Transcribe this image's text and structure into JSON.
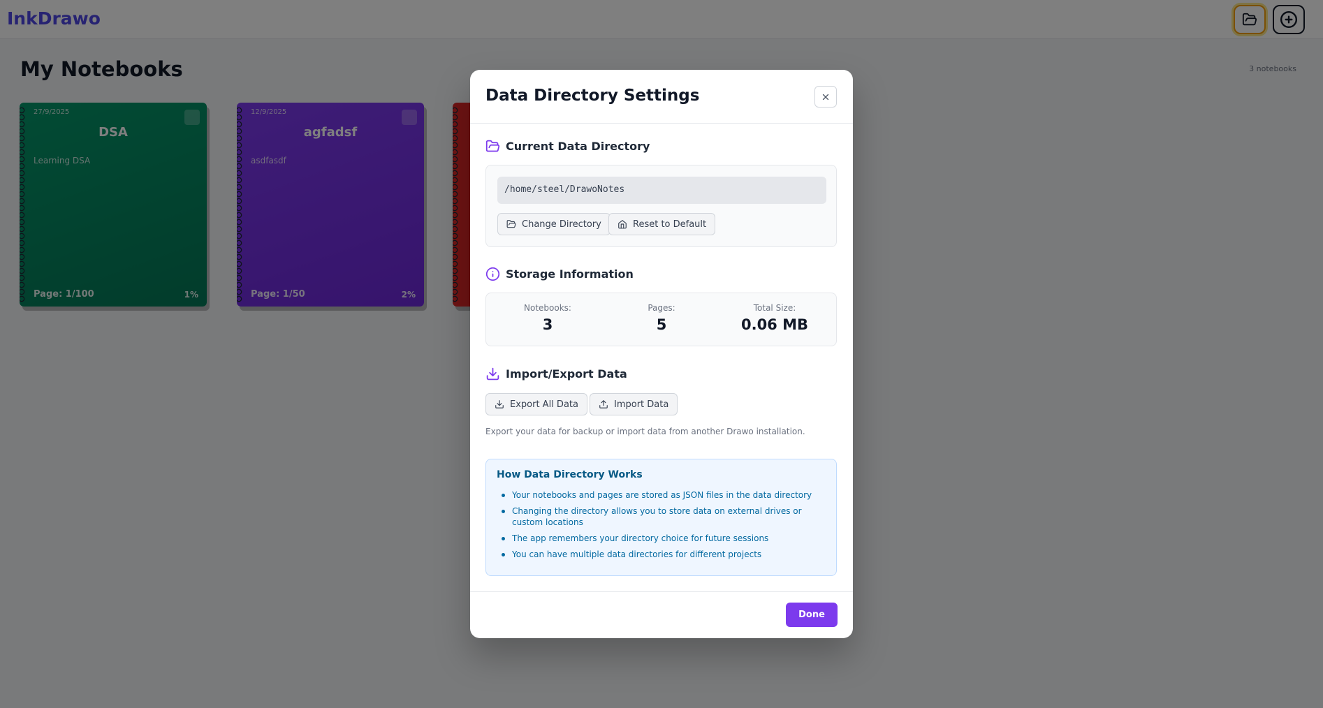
{
  "app": {
    "title": "InkDrawo"
  },
  "page": {
    "title": "My Notebooks",
    "notebook_count": "3 notebooks"
  },
  "notebooks": [
    {
      "date": "27/9/2025",
      "title": "DSA",
      "description": "Learning DSA",
      "page": "Page: 1/100",
      "progress": "1%",
      "color": "#059669"
    },
    {
      "date": "12/9/2025",
      "title": "agfadsf",
      "description": "asdfasdf",
      "page": "Page: 1/50",
      "progress": "2%",
      "color": "#7c3aed"
    },
    {
      "color": "#dc2626"
    }
  ],
  "modal": {
    "title": "Data Directory Settings",
    "current_dir": {
      "heading": "Current Data Directory",
      "path": "/home/steel/DrawoNotes",
      "change_label": "Change Directory",
      "reset_label": "Reset to Default"
    },
    "storage": {
      "heading": "Storage Information",
      "notebooks_label": "Notebooks:",
      "notebooks_value": "3",
      "pages_label": "Pages:",
      "pages_value": "5",
      "size_label": "Total Size:",
      "size_value": "0.06 MB"
    },
    "import_export": {
      "heading": "Import/Export Data",
      "export_label": "Export All Data",
      "import_label": "Import Data",
      "note": "Export your data for backup or import data from another Drawo installation."
    },
    "info": {
      "title": "How Data Directory Works",
      "items": [
        "Your notebooks and pages are stored as JSON files in the data directory",
        "Changing the directory allows you to store data on external drives or custom locations",
        "The app remembers your directory choice for future sessions",
        "You can have multiple data directories for different projects"
      ]
    },
    "done_label": "Done"
  },
  "colors": {
    "accent": "#7c3aed",
    "info_text": "#0369a1"
  }
}
